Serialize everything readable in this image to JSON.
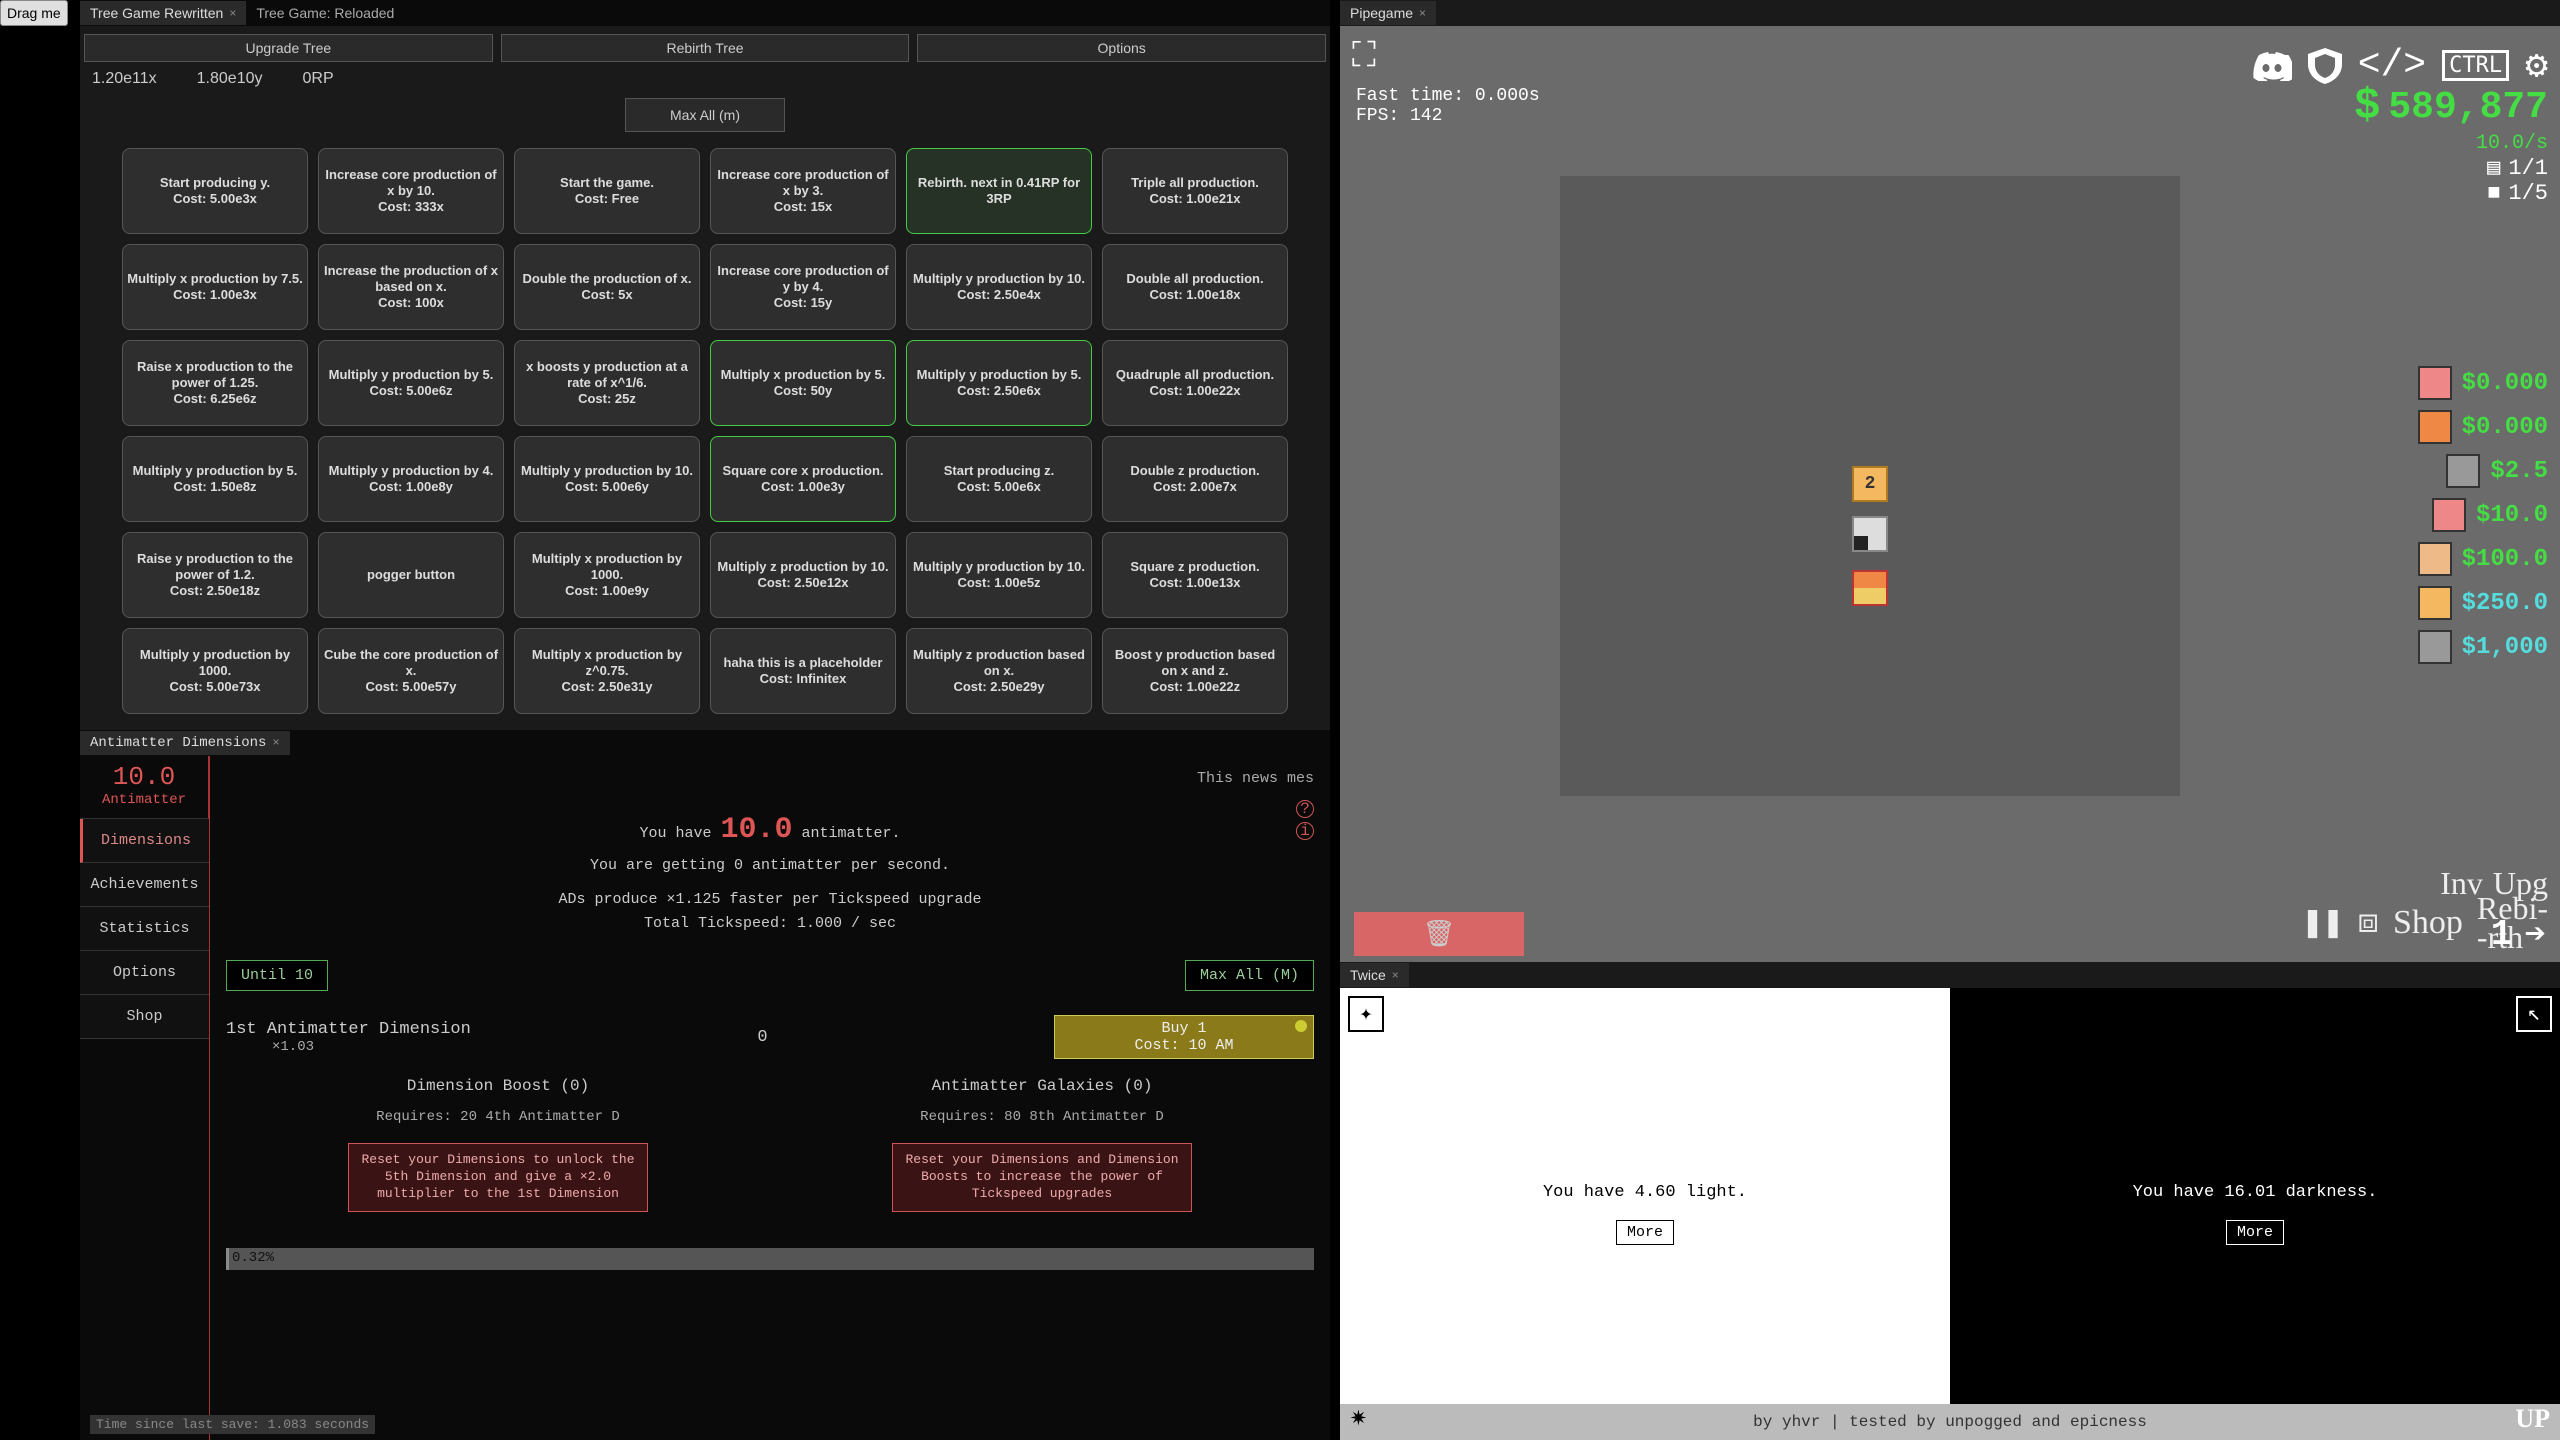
{
  "drag_label": "Drag me",
  "tree": {
    "tabs": [
      {
        "label": "Tree Game Rewritten",
        "active": true
      },
      {
        "label": "Tree Game: Reloaded",
        "active": false
      }
    ],
    "buttons": {
      "upgrade": "Upgrade Tree",
      "rebirth": "Rebirth Tree",
      "options": "Options"
    },
    "stats": {
      "a": "1.20e11x",
      "b": "1.80e10y",
      "c": "0RP"
    },
    "maxall": "Max All (m)",
    "nodes": [
      [
        {
          "t": "Start producing y.",
          "c": "Cost: 5.00e3x"
        },
        {
          "t": "Increase core production of x by 10.",
          "c": "Cost: 333x"
        },
        {
          "t": "Start the game.",
          "c": "Cost: Free"
        },
        {
          "t": "Increase core production of x by 3.",
          "c": "Cost: 15x"
        },
        {
          "t": "Rebirth. next in 0.41RP for 3RP",
          "c": "",
          "cls": "greenfill"
        },
        {
          "t": "Triple all production.",
          "c": "Cost: 1.00e21x"
        }
      ],
      [
        {
          "t": "Multiply x production by 7.5.",
          "c": "Cost: 1.00e3x"
        },
        {
          "t": "Increase the production of x based on x.",
          "c": "Cost: 100x"
        },
        {
          "t": "Double the production of x.",
          "c": "Cost: 5x"
        },
        {
          "t": "Increase core production of y by 4.",
          "c": "Cost: 15y"
        },
        {
          "t": "Multiply y production by 10.",
          "c": "Cost: 2.50e4x"
        },
        {
          "t": "Double all production.",
          "c": "Cost: 1.00e18x"
        }
      ],
      [
        {
          "t": "Raise x production to the power of 1.25.",
          "c": "Cost: 6.25e6z"
        },
        {
          "t": "Multiply y production by 5.",
          "c": "Cost: 5.00e6z"
        },
        {
          "t": "x boosts y production at a rate of x^1/6.",
          "c": "Cost: 25z"
        },
        {
          "t": "Multiply x production by 5.",
          "c": "Cost: 50y",
          "cls": "green"
        },
        {
          "t": "Multiply y production by 5.",
          "c": "Cost: 2.50e6x",
          "cls": "green"
        },
        {
          "t": "Quadruple all production.",
          "c": "Cost: 1.00e22x"
        }
      ],
      [
        {
          "t": "Multiply y production by 5.",
          "c": "Cost: 1.50e8z"
        },
        {
          "t": "Multiply y production by 4.",
          "c": "Cost: 1.00e8y"
        },
        {
          "t": "Multiply y production by 10.",
          "c": "Cost: 5.00e6y"
        },
        {
          "t": "Square core x production.",
          "c": "Cost: 1.00e3y",
          "cls": "green"
        },
        {
          "t": "Start producing z.",
          "c": "Cost: 5.00e6x"
        },
        {
          "t": "Double z production.",
          "c": "Cost: 2.00e7x"
        }
      ],
      [
        {
          "t": "Raise y production to the power of 1.2.",
          "c": "Cost: 2.50e18z"
        },
        {
          "t": "pogger button",
          "c": ""
        },
        {
          "t": "Multiply x production by 1000.",
          "c": "Cost: 1.00e9y"
        },
        {
          "t": "Multiply z production by 10.",
          "c": "Cost: 2.50e12x"
        },
        {
          "t": "Multiply y production by 10.",
          "c": "Cost: 1.00e5z"
        },
        {
          "t": "Square z production.",
          "c": "Cost: 1.00e13x"
        }
      ],
      [
        {
          "t": "Multiply y production by 1000.",
          "c": "Cost: 5.00e73x"
        },
        {
          "t": "Cube the core production of x.",
          "c": "Cost: 5.00e57y"
        },
        {
          "t": "Multiply x production by z^0.75.",
          "c": "Cost: 2.50e31y"
        },
        {
          "t": "haha this is a placeholder",
          "c": "Cost: Infinitex"
        },
        {
          "t": "Multiply z production based on x.",
          "c": "Cost: 2.50e29y"
        },
        {
          "t": "Boost y production based on x and z.",
          "c": "Cost: 1.00e22z"
        }
      ]
    ]
  },
  "ad": {
    "tab": "Antimatter Dimensions",
    "am_value": "10.0",
    "am_label": "Antimatter",
    "nav": [
      "Dimensions",
      "Achievements",
      "Statistics",
      "Options",
      "Shop"
    ],
    "news": "This news mes",
    "you_have_pre": "You have ",
    "you_have_val": "10.0",
    "you_have_post": " antimatter.",
    "per_sec": "You are getting 0 antimatter per second.",
    "tick1": "ADs produce ×1.125 faster per Tickspeed upgrade",
    "tick2": "Total Tickspeed: 1.000 / sec",
    "until10": "Until 10",
    "maxall": "Max All (M)",
    "dim_name": "1st Antimatter Dimension",
    "dim_mult": "×1.03",
    "dim_count": "0",
    "buy_l1": "Buy 1",
    "buy_l2": "Cost: 10 AM",
    "boost": {
      "title": "Dimension Boost (0)",
      "req": "Requires: 20 4th Antimatter D",
      "btn": "Reset your Dimensions to unlock the 5th Dimension and give a ×2.0 multiplier to the 1st Dimension"
    },
    "galaxy": {
      "title": "Antimatter Galaxies (0)",
      "req": "Requires: 80 8th Antimatter D",
      "btn": "Reset your Dimensions and Dimension Boosts to increase the power of Tickspeed upgrades"
    },
    "progress": "0.32%",
    "footer": "Time since last save: 1.083 seconds"
  },
  "pipe": {
    "tab": "Pipegame",
    "fast_time": "Fast time: 0.000s",
    "fps": "FPS: 142",
    "cash": "589,877",
    "rate": "10.0/s",
    "inv": "1/1",
    "stage": "1/5",
    "pf_badge": "2",
    "shop": [
      {
        "price": "$0.000",
        "cls": "c-green",
        "bg": "#e88"
      },
      {
        "price": "$0.000",
        "cls": "c-green",
        "bg": "#e84"
      },
      {
        "price": "$2.5",
        "cls": "c-green",
        "bg": "#999"
      },
      {
        "price": "$10.0",
        "cls": "c-green",
        "bg": "#e88"
      },
      {
        "price": "$100.0",
        "cls": "c-green",
        "bg": "#eb8"
      },
      {
        "price": "$250.0",
        "cls": "c-cyan",
        "bg": "#f4b860"
      },
      {
        "price": "$1,000",
        "cls": "c-cyan",
        "bg": "#999"
      }
    ],
    "sel_count": "1",
    "words": {
      "inv": "Inv",
      "upg": "Upg",
      "shop": "Shop",
      "rebirth1": "Rebi-",
      "rebirth2": "-rth"
    }
  },
  "twice": {
    "tab": "Twice",
    "light_text": "You have 4.60 light.",
    "dark_text": "You have 16.01 darkness.",
    "more": "More",
    "footer": "by yhvr | tested by unpogged and epicness",
    "up": "UP"
  }
}
